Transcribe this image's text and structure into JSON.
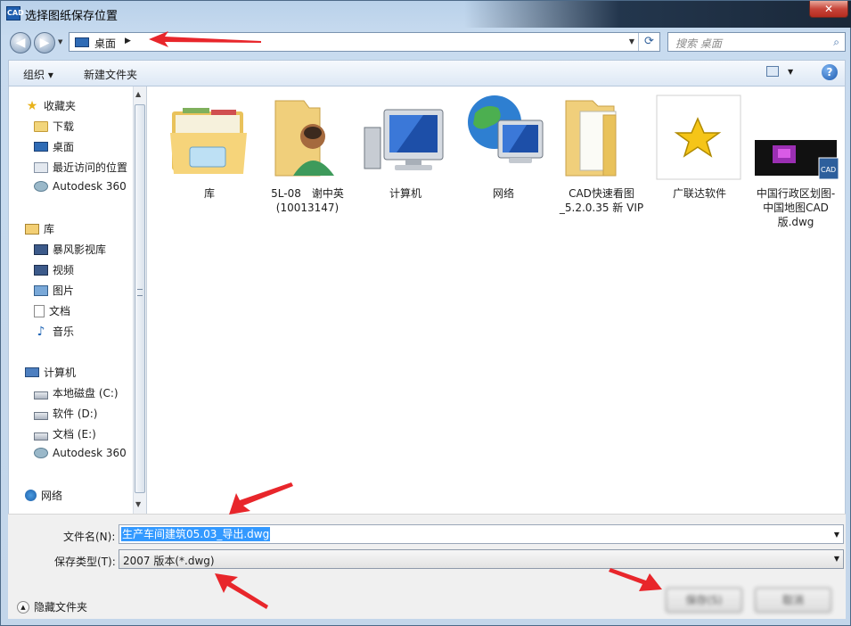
{
  "window": {
    "title": "选择图纸保存位置",
    "app_icon_text": "CAD",
    "close_label": "✕"
  },
  "address": {
    "location": "桌面",
    "search_placeholder": "搜索 桌面"
  },
  "toolbar": {
    "organize": "组织 ▾",
    "new_folder": "新建文件夹",
    "help": "?"
  },
  "sidebar": {
    "favorites": {
      "header": "收藏夹",
      "items": [
        "下载",
        "桌面",
        "最近访问的位置",
        "Autodesk 360"
      ]
    },
    "libraries": {
      "header": "库",
      "items": [
        "暴风影视库",
        "视频",
        "图片",
        "文档",
        "音乐"
      ]
    },
    "computer": {
      "header": "计算机",
      "items": [
        "本地磁盘 (C:)",
        "软件 (D:)",
        "文档 (E:)",
        "Autodesk 360"
      ]
    },
    "network": {
      "header": "网络"
    }
  },
  "files": [
    {
      "name": "库"
    },
    {
      "name": "5L-08　谢中英 (10013147)"
    },
    {
      "name": "计算机"
    },
    {
      "name": "网络"
    },
    {
      "name": "CAD快速看图_5.2.0.35 新 VIP"
    },
    {
      "name": "广联达软件"
    },
    {
      "name": "中国行政区划图-中国地图CAD版.dwg"
    }
  ],
  "form": {
    "filename_label": "文件名(N):",
    "filename_value": "生产车间建筑05.03_导出.dwg",
    "filetype_label": "保存类型(T):",
    "filetype_value": "2007 版本(*.dwg)",
    "hide_folders": "隐藏文件夹",
    "save_button": "保存(S)",
    "cancel_button": "取消"
  },
  "colors": {
    "annotation_arrow": "#e8262b",
    "selection": "#3399ff"
  }
}
